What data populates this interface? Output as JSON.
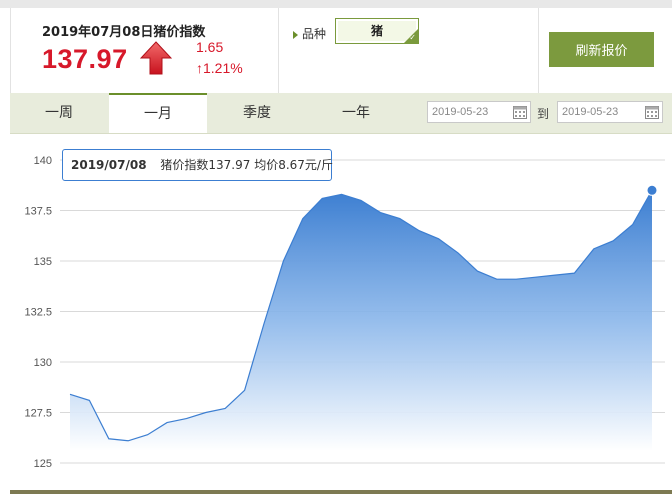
{
  "header": {
    "title": "2019年07月08日猪价指数",
    "index_value": "137.97",
    "change": "1.65",
    "change_pct": "↑1.21%",
    "variety_label": "品种",
    "variety_value": "猪",
    "refresh_label": "刷新报价"
  },
  "tabs": [
    {
      "label": "一周",
      "active": false
    },
    {
      "label": "一月",
      "active": true
    },
    {
      "label": "季度",
      "active": false
    },
    {
      "label": "一年",
      "active": false
    }
  ],
  "date_range": {
    "start": "2019-05-23",
    "to_label": "到",
    "end": "2019-05-23"
  },
  "tooltip": {
    "date": "2019/07/08",
    "text": "猪价指数137.97    均价8.67元/斤"
  },
  "colors": {
    "accent_green": "#7c9a3e",
    "price_red": "#d7182a",
    "series_blue": "#3c7ed1"
  },
  "chart_data": {
    "type": "area",
    "y_ticks": [
      "140",
      "137.5",
      "135",
      "132.5",
      "130",
      "127.5",
      "125"
    ],
    "ylim": [
      125,
      140
    ],
    "grid": true,
    "series": [
      {
        "values": [
          128.4,
          128.1,
          126.2,
          126.1,
          126.4,
          127.0,
          127.2,
          127.5,
          127.7,
          128.6,
          131.9,
          135.0,
          137.1,
          138.1,
          138.3,
          138.0,
          137.4,
          137.1,
          136.5,
          136.1,
          135.4,
          134.5,
          134.1,
          134.1,
          134.2,
          134.3,
          134.4,
          135.6,
          136.0,
          136.8,
          138.5
        ]
      }
    ]
  }
}
